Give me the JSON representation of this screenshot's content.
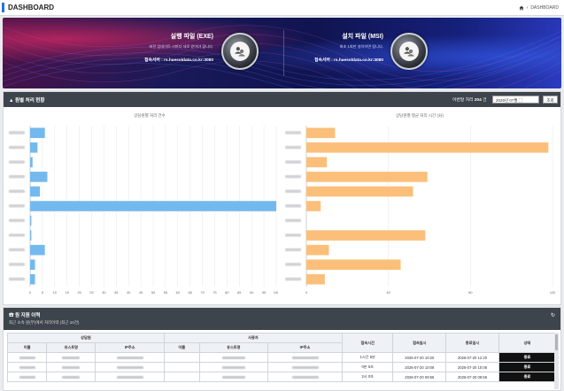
{
  "header": {
    "title": "DASHBOARD",
    "breadcrumb": "DASHBOARD",
    "home_icon": "home-icon"
  },
  "downloads": [
    {
      "title": "실행 파일 (EXE)",
      "desc": "버전 업데이트 시마다 새로 받아야 합니다.",
      "server": "접속서버 : rs.haesoldata.co.kr:3080",
      "icon": "users-icon"
    },
    {
      "title": "설치 파일 (MSI)",
      "desc": "최초 1회만 설치하면 됩니다.",
      "server": "접속서버 : rs.haesoldata.co.kr:3080",
      "icon": "users-icon"
    }
  ],
  "status_panel": {
    "title": "원별 처리 현황",
    "count_label": "이번달 처리",
    "count": "204",
    "count_unit": "건",
    "date_value": "2026년 07월",
    "query_label": "조회",
    "colors": {
      "blue": "#74b9ee",
      "orange": "#fbbf7a",
      "header": "#3e444c"
    }
  },
  "chart_data": [
    {
      "type": "bar",
      "orientation": "horizontal",
      "title": "상담원별 처리 건수",
      "values": [
        6,
        3,
        1,
        7,
        4,
        100,
        0.5,
        0.5,
        6,
        2,
        2
      ],
      "xlim": [
        0,
        100
      ],
      "xticks": [
        "0",
        "5",
        "10",
        "15",
        "20",
        "25",
        "30",
        "35",
        "40",
        "45",
        "50",
        "55",
        "60",
        "65",
        "70",
        "75",
        "80",
        "85",
        "90",
        "95",
        "100"
      ],
      "color": "#74b9ee"
    },
    {
      "type": "bar",
      "orientation": "horizontal",
      "title": "상담원별 평균 처리 시간 (分)",
      "values": [
        14,
        118,
        10,
        59,
        52,
        7,
        0,
        58,
        11,
        46,
        9
      ],
      "xlim": [
        0,
        120
      ],
      "xticks": [
        "0",
        "40",
        "80",
        "120"
      ],
      "color": "#fbbf7a"
    }
  ],
  "support": {
    "title": "원 지원 이력",
    "subtitle": "최근 소속 원(부)에서 처리이력 (최근 10건)",
    "group_agent": "상담원",
    "group_requester": "사용자",
    "col_name": "이름",
    "col_user": "유스트명",
    "col_ip": "IP주소",
    "col_time": "접속시간",
    "col_connect": "접속일시",
    "col_end": "종료일시",
    "col_status": "상태",
    "rows": [
      {
        "duration": "1시간 5분",
        "connect": "2026-07-20 10:20",
        "end": "2026-07-20 12:20",
        "status": "종료"
      },
      {
        "duration": "0분 5초",
        "connect": "2026-07-20 10:08",
        "end": "2026-07-20 10:08",
        "status": "종료"
      },
      {
        "duration": "2시 0초",
        "connect": "2026-07-20 09:56",
        "end": "2026-07-20 09:56",
        "status": "종료"
      }
    ]
  }
}
